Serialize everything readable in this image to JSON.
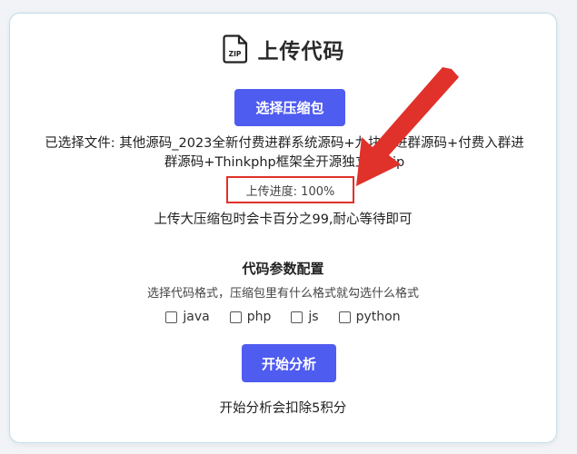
{
  "header": {
    "title": "上传代码",
    "icon": "zip-file-icon",
    "icon_text": "ZIP"
  },
  "upload": {
    "select_button_label": "选择压缩包",
    "selected_file_text": "已选择文件: 其他源码_2023全新付费进群系统源码+九块九进群源码+付费入群进群源码+Thinkphp框架全开源独立版.zip",
    "progress_text": "上传进度: 100%",
    "progress_percent": 100,
    "wait_hint": "上传大压缩包时会卡百分之99,耐心等待即可"
  },
  "config": {
    "section_title": "代码参数配置",
    "section_desc": "选择代码格式，压缩包里有什么格式就勾选什么格式",
    "formats": [
      {
        "label": "java",
        "checked": false
      },
      {
        "label": "php",
        "checked": false
      },
      {
        "label": "js",
        "checked": false
      },
      {
        "label": "python",
        "checked": false
      }
    ]
  },
  "action": {
    "start_button_label": "开始分析",
    "cost_note": "开始分析会扣除5积分"
  },
  "colors": {
    "accent": "#4f5cf0",
    "annotation": "#e0312a"
  }
}
